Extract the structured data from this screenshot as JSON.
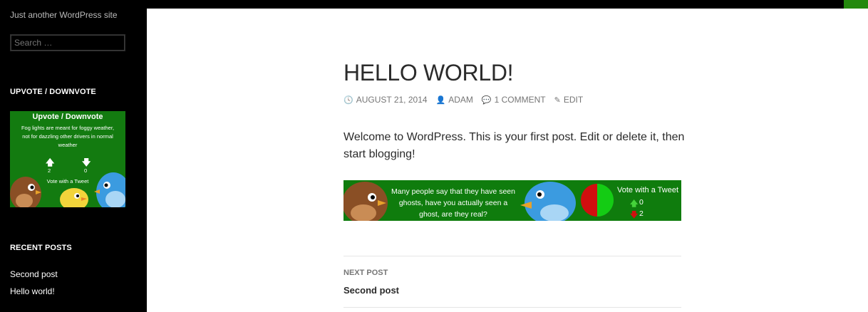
{
  "site": {
    "tagline": "Just another WordPress site",
    "accent": "#24890d"
  },
  "search": {
    "placeholder": "Search …"
  },
  "sidebar": {
    "widget_upvote_title": "UPVOTE / DOWNVOTE",
    "vote_widget": {
      "title": "Upvote / Downvote",
      "text": "Fog lights are meant for foggy weather, not for dazzling other drivers in normal weather",
      "up_icon": "arrow-up-icon",
      "down_icon": "arrow-down-icon",
      "up_count": "2",
      "down_count": "0",
      "cta": "Vote with a Tweet"
    },
    "recent_title": "RECENT POSTS",
    "recent_posts": [
      "Second post",
      "Hello world!"
    ]
  },
  "post": {
    "title": "HELLO WORLD!",
    "date": "AUGUST 21, 2014",
    "author": "ADAM",
    "comments": "1 COMMENT",
    "edit": "EDIT",
    "content": "Welcome to WordPress. This is your first post. Edit or delete it, then start blogging!"
  },
  "banner": {
    "text": "Many people say that they have seen ghosts, have you actually seen a ghost, are they real?",
    "cta": "Vote with a Tweet",
    "up_count": "0",
    "down_count": "2",
    "pie_colors": [
      "#d10f0f",
      "#14cc14"
    ]
  },
  "post_nav": {
    "label": "NEXT POST",
    "link": "Second post"
  }
}
